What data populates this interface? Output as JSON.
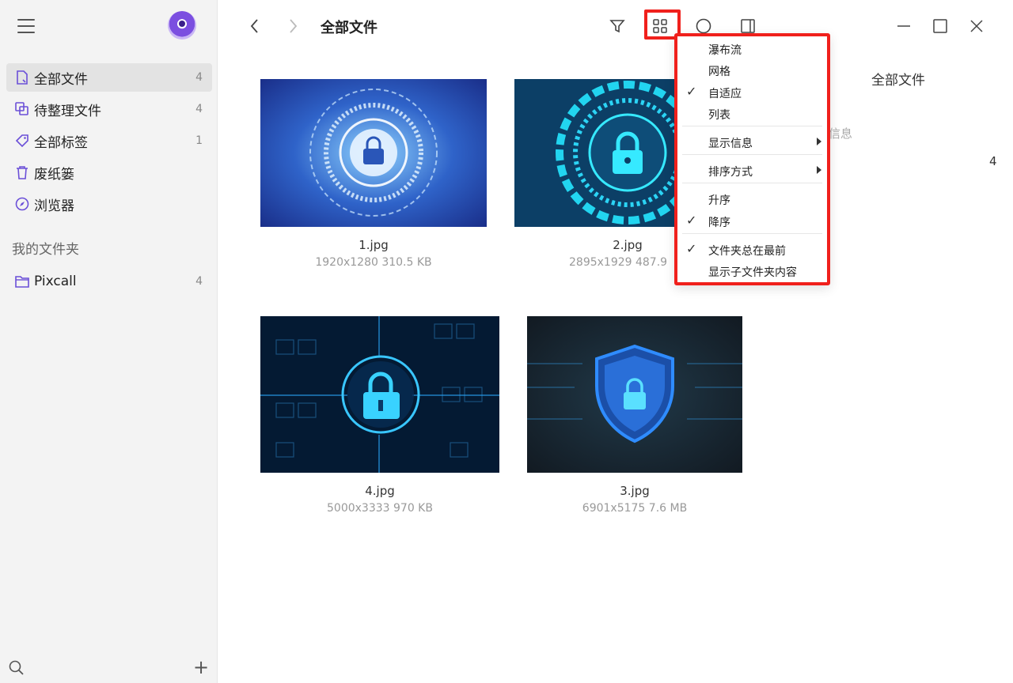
{
  "sidebar": {
    "nav": [
      {
        "label": "全部文件",
        "count": "4",
        "icon": "file-icon"
      },
      {
        "label": "待整理文件",
        "count": "4",
        "icon": "copy-icon"
      },
      {
        "label": "全部标签",
        "count": "1",
        "icon": "tag-icon"
      },
      {
        "label": "废纸篓",
        "count": "",
        "icon": "trash-icon"
      },
      {
        "label": "浏览器",
        "count": "",
        "icon": "compass-icon"
      }
    ],
    "section_title": "我的文件夹",
    "folders": [
      {
        "label": "Pixcall",
        "count": "4",
        "icon": "folder-icon"
      }
    ]
  },
  "header": {
    "title": "全部文件"
  },
  "files": [
    {
      "name": "1.jpg",
      "meta": "1920x1280   310.5 KB"
    },
    {
      "name": "2.jpg",
      "meta": "2895x1929   487.9"
    },
    {
      "name": "4.jpg",
      "meta": "5000x3333   970 KB"
    },
    {
      "name": "3.jpg",
      "meta": "6901x5175   7.6 MB"
    }
  ],
  "right_panel": {
    "title": "全部文件",
    "sub": "信息",
    "count": "4"
  },
  "menu": {
    "items": [
      {
        "label": "瀑布流",
        "checked": false,
        "submenu": false
      },
      {
        "label": "网格",
        "checked": false,
        "submenu": false
      },
      {
        "label": "自适应",
        "checked": true,
        "submenu": false
      },
      {
        "label": "列表",
        "checked": false,
        "submenu": false
      },
      {
        "label": "显示信息",
        "checked": false,
        "submenu": true
      },
      {
        "label": "排序方式",
        "checked": false,
        "submenu": true
      },
      {
        "label": "升序",
        "checked": false,
        "submenu": false
      },
      {
        "label": "降序",
        "checked": true,
        "submenu": false
      },
      {
        "label": "文件夹总在最前",
        "checked": true,
        "submenu": false
      },
      {
        "label": "显示子文件夹内容",
        "checked": false,
        "submenu": false
      }
    ],
    "check_glyph": "✓"
  },
  "colors": {
    "highlight": "#f0201c",
    "accent": "#7b4fe0"
  }
}
